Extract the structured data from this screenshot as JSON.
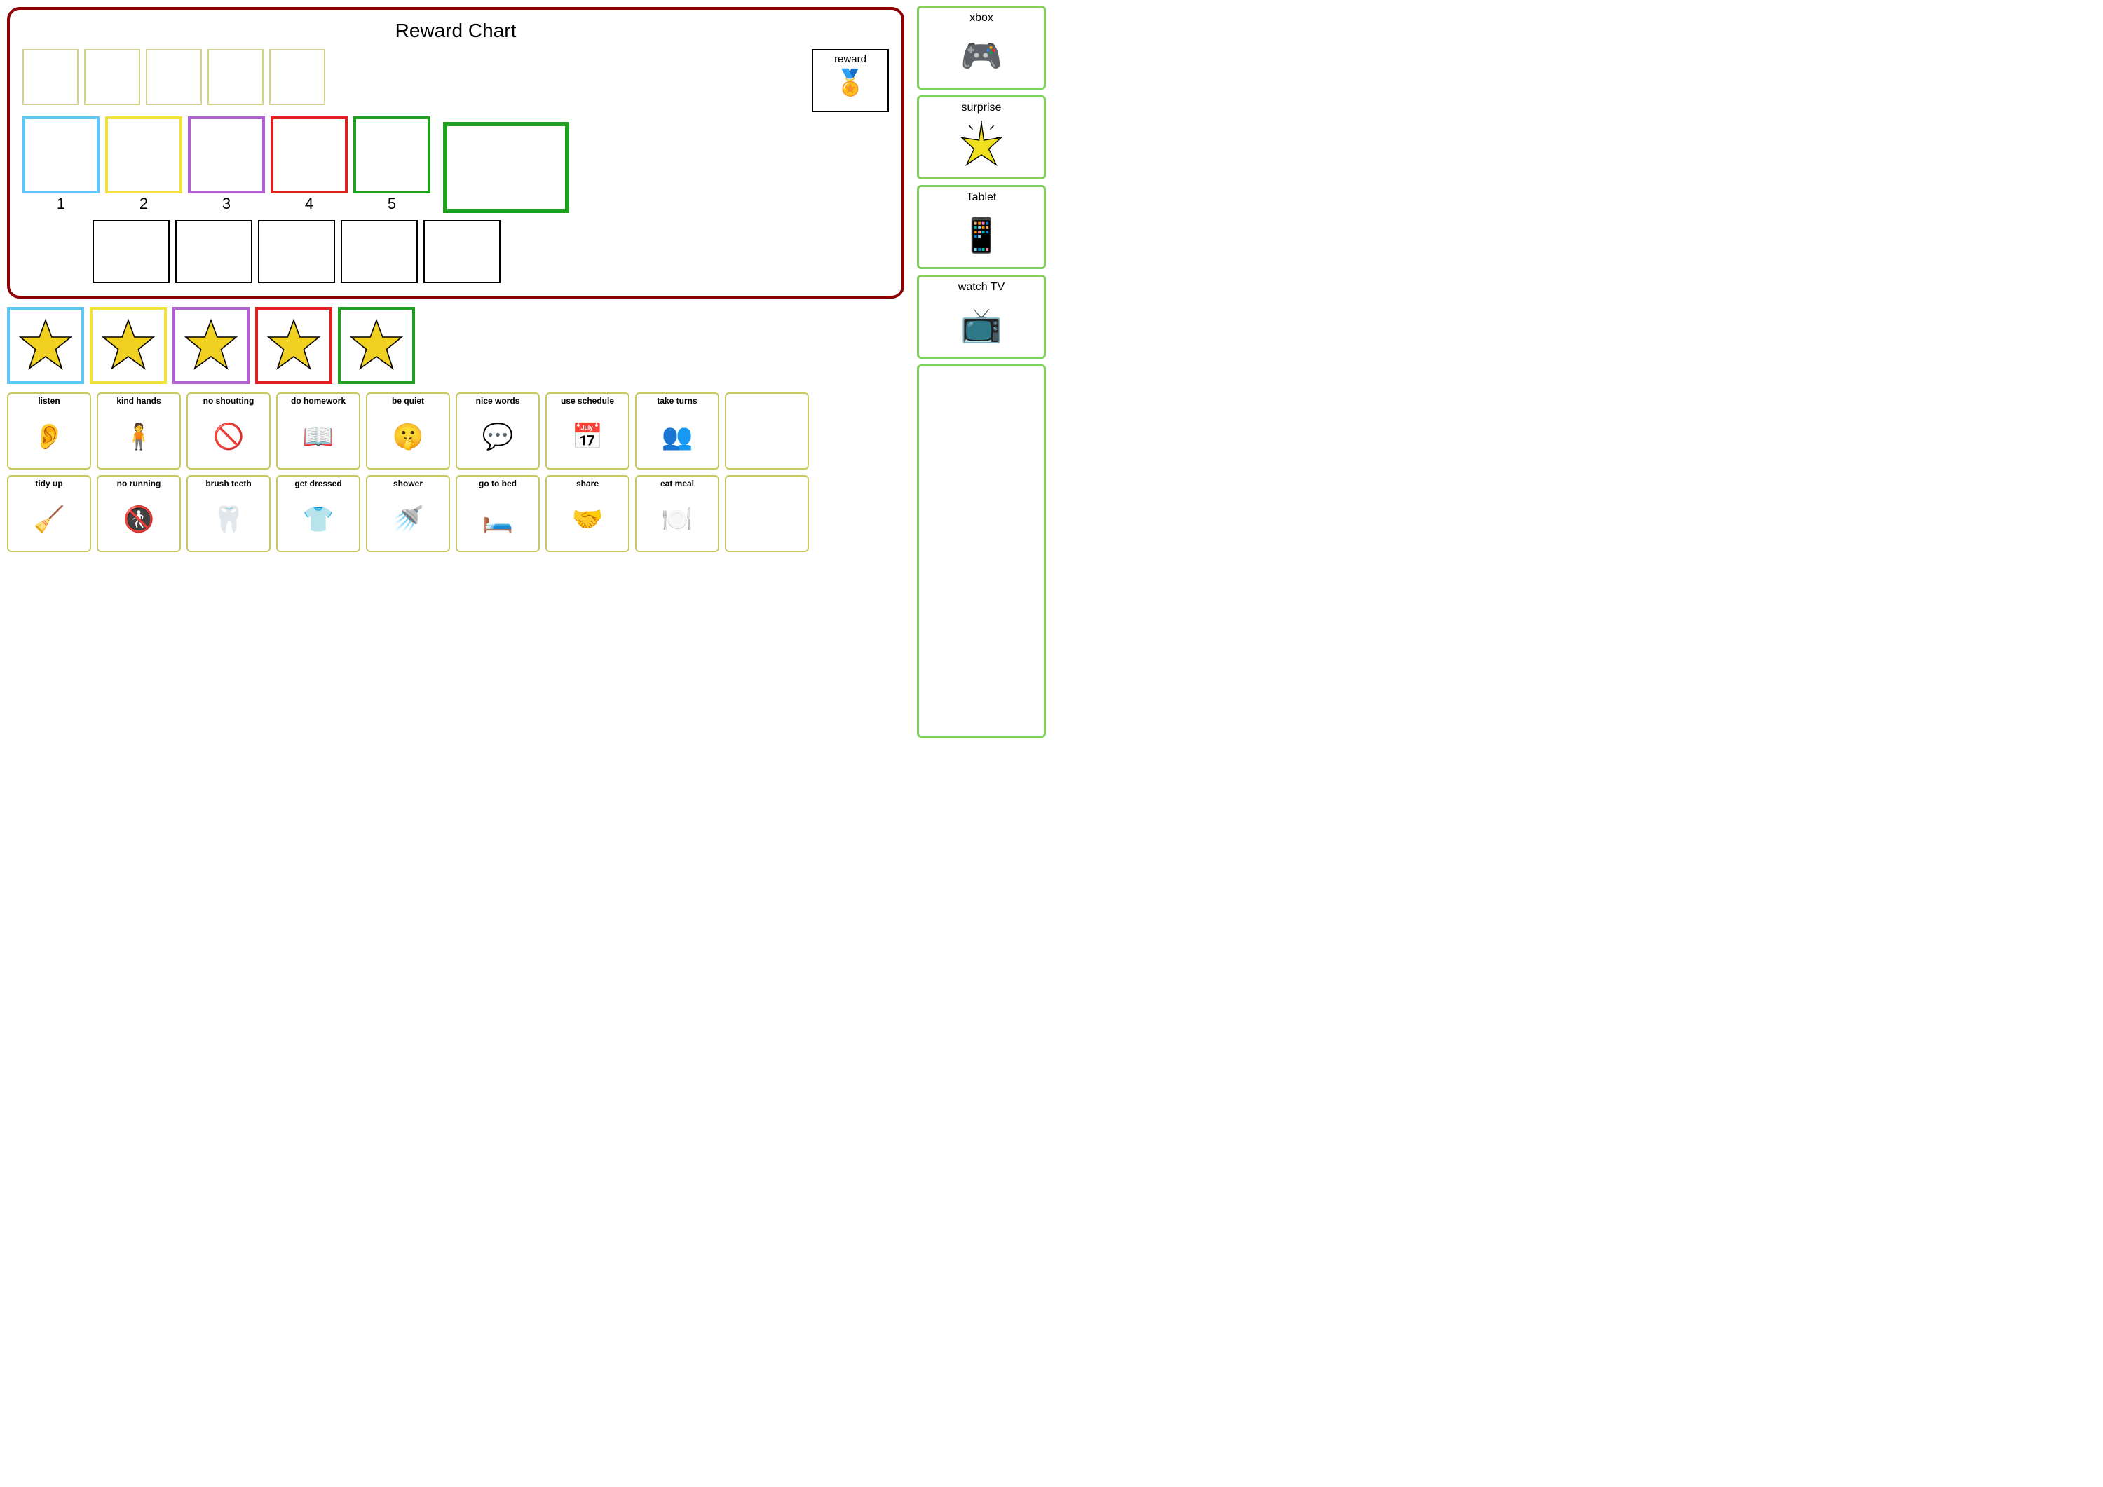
{
  "rewardChart": {
    "title": "Reward Chart",
    "rewardLabel": "reward",
    "rewardIcon": "🏅",
    "numberedBoxes": [
      {
        "number": "1",
        "color": "blue"
      },
      {
        "number": "2",
        "color": "yellow"
      },
      {
        "number": "3",
        "color": "purple"
      },
      {
        "number": "4",
        "color": "red"
      },
      {
        "number": "5",
        "color": "green-dark"
      }
    ]
  },
  "stars": [
    {
      "color": "blue"
    },
    {
      "color": "yellow"
    },
    {
      "color": "purple"
    },
    {
      "color": "red"
    },
    {
      "color": "green"
    }
  ],
  "taskRow1": [
    {
      "label": "listen",
      "icon": "👂"
    },
    {
      "label": "kind hands",
      "icon": "🧍"
    },
    {
      "label": "no shoutting",
      "icon": "🚫"
    },
    {
      "label": "do homework",
      "icon": "📖"
    },
    {
      "label": "be quiet",
      "icon": "🤫"
    },
    {
      "label": "nice words",
      "icon": "💬"
    },
    {
      "label": "use schedule",
      "icon": "📅"
    },
    {
      "label": "take turns",
      "icon": "👥"
    },
    {
      "label": "",
      "icon": ""
    }
  ],
  "taskRow2": [
    {
      "label": "tidy up",
      "icon": "🧹"
    },
    {
      "label": "no running",
      "icon": "🚶"
    },
    {
      "label": "brush teeth",
      "icon": "🦷"
    },
    {
      "label": "get dressed",
      "icon": "👕"
    },
    {
      "label": "shower",
      "icon": "🚿"
    },
    {
      "label": "go to bed",
      "icon": "🛏"
    },
    {
      "label": "share",
      "icon": "🤝"
    },
    {
      "label": "eat meal",
      "icon": "🍽"
    },
    {
      "label": "",
      "icon": ""
    }
  ],
  "rewardItems": [
    {
      "label": "xbox",
      "icon": "🎮"
    },
    {
      "label": "surprise",
      "icon": "⭐"
    },
    {
      "label": "Tablet",
      "icon": "📱"
    },
    {
      "label": "watch TV",
      "icon": "📺"
    },
    {
      "label": "",
      "icon": ""
    }
  ]
}
